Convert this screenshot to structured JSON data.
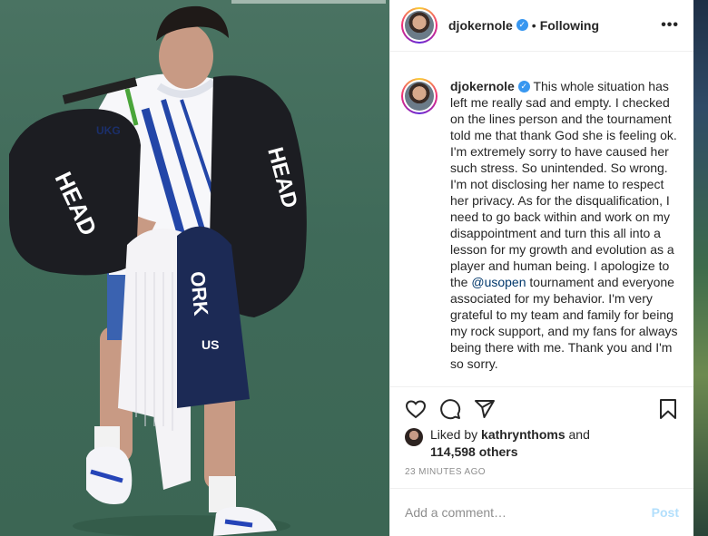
{
  "header": {
    "username": "djokernole",
    "separator": "•",
    "follow_status": "Following",
    "more_icon": "more-horizontal-icon"
  },
  "caption": {
    "username": "djokernole",
    "text": "This whole situation has left me really sad and empty. I checked on the lines person and the tournament told me that thank God she is feeling ok. I'm extremely sorry to have caused her such stress. So unintended. So wrong. I'm not disclosing her name to respect her privacy. As for the disqualification, I need to go back within and work on my disappointment and turn this all into a lesson for my growth and evolution as a player and human being. I apologize to the",
    "mention": "@usopen",
    "text_after": "tournament and everyone associated for my behavior. I'm very grateful to my team and family for being my rock support, and my fans for always being there with me. Thank you and I'm so sorry."
  },
  "actions": {
    "like_icon": "heart-icon",
    "comment_icon": "comment-icon",
    "share_icon": "share-icon",
    "save_icon": "bookmark-icon"
  },
  "likes": {
    "prefix": "Liked by",
    "liker": "kathrynthoms",
    "connector": "and",
    "others": "114,598 others"
  },
  "timestamp": "23 MINUTES AGO",
  "comment": {
    "placeholder": "Add a comment…",
    "post_label": "Post"
  },
  "photo": {
    "bag_text_left": "HEAD",
    "bag_text_right": "HEAD",
    "shirt_logo": "UKG",
    "towel_text_1": "ORK",
    "towel_text_2": "US"
  },
  "colors": {
    "verified_blue": "#3897f0",
    "post_disabled": "#b2dffc",
    "mention": "#00376b",
    "muted": "#8e8e8e"
  }
}
